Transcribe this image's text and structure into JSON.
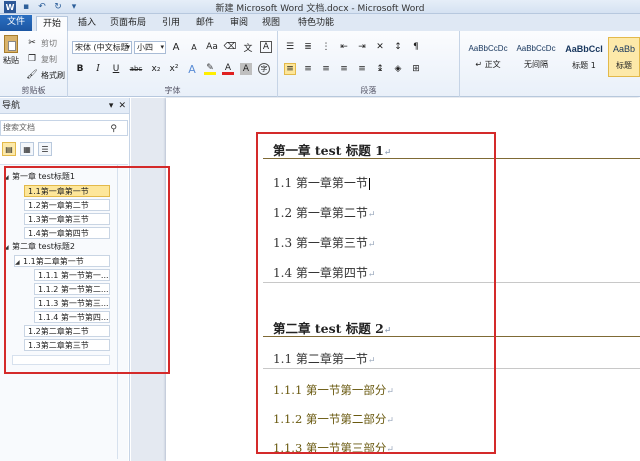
{
  "window": {
    "title": "新建 Microsoft Word 文档.docx - Microsoft Word"
  },
  "tabs": [
    "文件",
    "开始",
    "插入",
    "页面布局",
    "引用",
    "邮件",
    "审阅",
    "视图",
    "特色功能"
  ],
  "clipboard": {
    "paste": "粘贴",
    "cut": "剪切",
    "copy": "复制",
    "format_painter": "格式刷",
    "label": "剪贴板"
  },
  "font": {
    "family": "宋体 (中文标题",
    "size": "小四",
    "label": "字体",
    "bold": "B",
    "italic": "I",
    "underline": "U",
    "strike": "abc",
    "sub": "x₂",
    "sup": "x²",
    "grow": "A",
    "shrink": "A",
    "case": "Aa",
    "text_effect": "A",
    "font_color": "A"
  },
  "paragraph": {
    "label": "段落"
  },
  "styles": [
    {
      "sample": "AaBbCcDc",
      "name": "↵ 正文"
    },
    {
      "sample": "AaBbCcDc",
      "name": "无间隔"
    },
    {
      "sample": "AaBbCcI",
      "name": "标题 1"
    },
    {
      "sample": "AaBb",
      "name": "标题"
    }
  ],
  "nav": {
    "title": "导航",
    "search_placeholder": "搜索文档",
    "items": [
      {
        "label": "第一章  test标题1",
        "level": 1
      },
      {
        "label": "1.1第一章第一节",
        "level": 2,
        "selected": true
      },
      {
        "label": "1.2第一章第二节",
        "level": 2
      },
      {
        "label": "1.3第一章第三节",
        "level": 2
      },
      {
        "label": "1.4第一章第四节",
        "level": 2
      },
      {
        "label": "第二章  test标题2",
        "level": 1
      },
      {
        "label": "1.1第二章第一节",
        "level": 2
      },
      {
        "label": "1.1.1 第一节第一...",
        "level": 3
      },
      {
        "label": "1.1.2 第一节第二...",
        "level": 3
      },
      {
        "label": "1.1.3 第一节第三...",
        "level": 3
      },
      {
        "label": "1.1.4 第一节第四...",
        "level": 3
      },
      {
        "label": "1.2第二章第二节",
        "level": 2
      },
      {
        "label": "1.3第二章第三节",
        "level": 2
      }
    ]
  },
  "document": {
    "lines": [
      {
        "text": "第一章   test 标题 1",
        "kind": "h1"
      },
      {
        "text": "1.1 第一章第一节",
        "kind": "h2"
      },
      {
        "text": "1.2 第一章第二节",
        "kind": "h2"
      },
      {
        "text": "1.3 第一章第三节",
        "kind": "h2"
      },
      {
        "text": "1.4 第一章第四节",
        "kind": "h2"
      },
      {
        "text": "第二章   test 标题 2",
        "kind": "h1"
      },
      {
        "text": "1.1 第二章第一节",
        "kind": "h2"
      },
      {
        "text": "1.1.1  第一节第一部分",
        "kind": "h3"
      },
      {
        "text": "1.1.2  第一节第二部分",
        "kind": "h3"
      },
      {
        "text": "1.1.3  第一节第三部分",
        "kind": "h3"
      }
    ]
  },
  "colors": {
    "highlight_box": "#d42a2a",
    "ribbon_file_tab": "#1c56a2",
    "selected_nav": "#fde69a"
  }
}
